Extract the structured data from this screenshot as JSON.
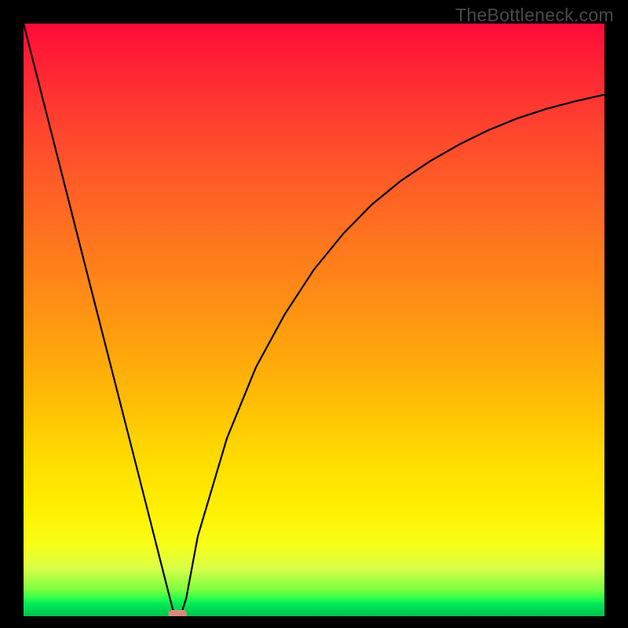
{
  "watermark": "TheBottleneck.com",
  "chart_data": {
    "type": "line",
    "title": "",
    "xlabel": "",
    "ylabel": "",
    "xlim": [
      0,
      100
    ],
    "ylim": [
      0,
      100
    ],
    "series": [
      {
        "name": "curve",
        "x": [
          0,
          5,
          10,
          15,
          20,
          25,
          26,
          27,
          28,
          30,
          35,
          40,
          45,
          50,
          55,
          60,
          65,
          70,
          75,
          80,
          85,
          90,
          95,
          100
        ],
        "values": [
          100,
          80.8,
          61.5,
          42.3,
          23.1,
          3.8,
          0,
          0,
          3,
          13.5,
          30,
          42,
          51,
          58.5,
          64.5,
          69.5,
          73.5,
          76.8,
          79.6,
          82,
          84,
          85.6,
          86.9,
          88
        ]
      }
    ],
    "marker": {
      "x": 26.5,
      "y": 0
    },
    "gradient_stops": [
      {
        "pos": 0,
        "color": "#ff0a3a"
      },
      {
        "pos": 50,
        "color": "#ff8c15"
      },
      {
        "pos": 80,
        "color": "#fff000"
      },
      {
        "pos": 100,
        "color": "#00c24a"
      }
    ]
  }
}
